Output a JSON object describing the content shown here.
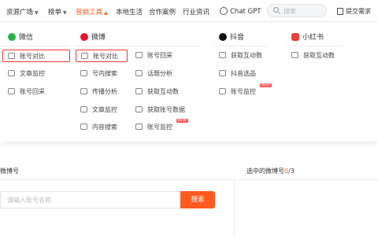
{
  "nav": {
    "resources": "资源广场",
    "rankings": "榜单",
    "marketing_tools": "营销工具",
    "local_life": "本地生活",
    "cases": "合作案例",
    "industry_news": "行业资讯",
    "chatgpt": "Chat GPT",
    "search_placeholder": "搜索",
    "submit_request": "提交需求"
  },
  "dropdown": {
    "wechat": {
      "title": "微信",
      "items": [
        "账号对比",
        "文章监控",
        "账号回采"
      ]
    },
    "weibo": {
      "title": "微博",
      "left_items": [
        "账号对比",
        "号内搜索",
        "传播分析",
        "文章监控",
        "内容搜索"
      ],
      "right_items": [
        "账号回采",
        "话题分析",
        "获取互动数",
        "获取账号数据",
        "账号监控"
      ]
    },
    "douyin": {
      "title": "抖音",
      "items": [
        "获取互动数",
        "抖音选品",
        "账号监控"
      ]
    },
    "xiaohongshu": {
      "title": "小红书",
      "items": [
        "获取互动数"
      ]
    },
    "badge_text": "NEW"
  },
  "panel": {
    "label": "微博号",
    "selected_prefix": "选中的微博号",
    "selected_count": "0",
    "selected_total": "/3",
    "input_placeholder": "请输入账号名称",
    "search_button": "搜索"
  },
  "colors": {
    "accent": "#ff5a1f",
    "selected_border": "#e53935",
    "new_badge": "#ff5a5a"
  }
}
